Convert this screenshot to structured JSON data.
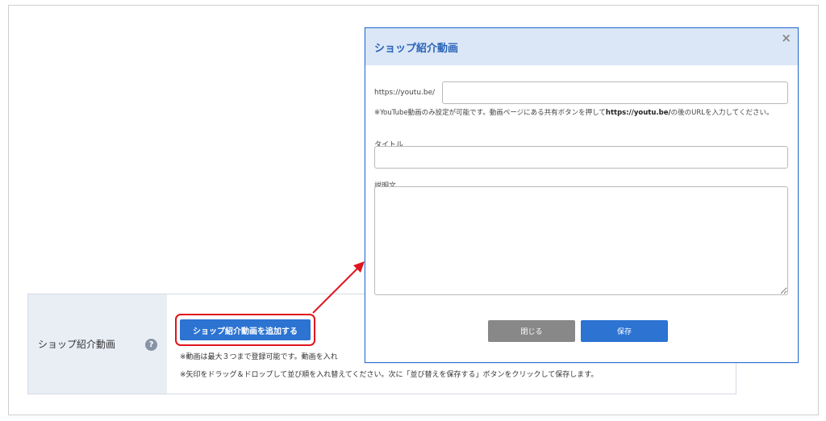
{
  "settings_row": {
    "label": "ショップ紹介動画",
    "help_glyph": "?",
    "add_button_label": "ショップ紹介動画を追加する",
    "note_1": "※動画は最大３つまで登録可能です。動画を入れ",
    "note_2": "※矢印をドラッグ＆ドロップして並び順を入れ替えてください。次に「並び替えを保存する」ボタンをクリックして保存します。"
  },
  "modal": {
    "title": "ショップ紹介動画",
    "close_glyph": "×",
    "url_prefix_label": "https://youtu.be/",
    "url_value": "",
    "hint_part1": "※YouTube動画のみ設定が可能です。動画ページにある共有ボタンを押して",
    "hint_bold": "https://youtu.be/",
    "hint_part2": "の後のURLを入力してください。",
    "title_label": "タイトル",
    "title_value": "",
    "description_label": "説明文",
    "description_value": "",
    "close_button_label": "閉じる",
    "save_button_label": "保存"
  },
  "colors": {
    "accent": "#2c73d2",
    "highlight": "#e0141e",
    "header_bg": "#dbe7f7",
    "label_bg": "#e9eef5"
  },
  "icons": {
    "help": "question-circle-icon",
    "close": "close-icon",
    "arrow": "red-arrow-annotation"
  }
}
